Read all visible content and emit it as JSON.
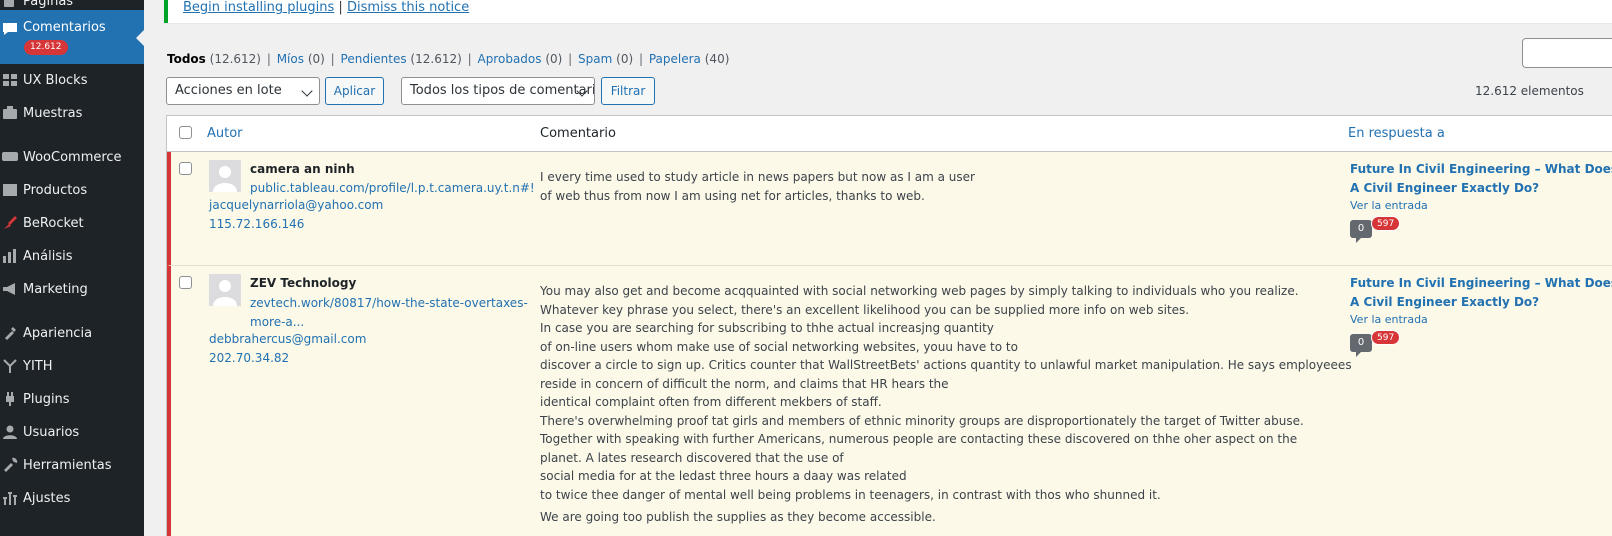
{
  "sidebar": {
    "items": [
      {
        "label": "Páginas",
        "icon": "pages-icon"
      },
      {
        "label": "Comentarios",
        "icon": "comments-icon",
        "count": "12.612"
      },
      {
        "label": "UX Blocks",
        "icon": "ux-blocks-icon"
      },
      {
        "label": "Muestras",
        "icon": "portfolio-icon"
      },
      {
        "label": "WooCommerce",
        "icon": "woocommerce-icon"
      },
      {
        "label": "Productos",
        "icon": "products-icon"
      },
      {
        "label": "BeRocket",
        "icon": "berocket-icon"
      },
      {
        "label": "Análisis",
        "icon": "analytics-icon"
      },
      {
        "label": "Marketing",
        "icon": "marketing-icon"
      },
      {
        "label": "Apariencia",
        "icon": "appearance-icon"
      },
      {
        "label": "YITH",
        "icon": "yith-icon"
      },
      {
        "label": "Plugins",
        "icon": "plugins-icon"
      },
      {
        "label": "Usuarios",
        "icon": "users-icon"
      },
      {
        "label": "Herramientas",
        "icon": "tools-icon"
      },
      {
        "label": "Ajustes",
        "icon": "settings-icon"
      }
    ]
  },
  "notice": {
    "install_link": "Begin installing plugins",
    "separator": "|",
    "dismiss_link": "Dismiss this notice"
  },
  "filters": {
    "all": {
      "label": "Todos",
      "count": "(12.612)"
    },
    "mine": {
      "label": "Míos",
      "count": "(0)"
    },
    "pending": {
      "label": "Pendientes",
      "count": "(12.612)"
    },
    "approved": {
      "label": "Aprobados",
      "count": "(0)"
    },
    "spam": {
      "label": "Spam",
      "count": "(0)"
    },
    "trash": {
      "label": "Papelera",
      "count": "(40)"
    },
    "sep": "|"
  },
  "tablenav": {
    "bulk_actions": "Acciones en lote",
    "apply": "Aplicar",
    "comment_type": "Todos los tipos de comentarios",
    "filter": "Filtrar",
    "items_count": "12.612 elementos"
  },
  "table": {
    "headers": {
      "author": "Autor",
      "comment": "Comentario",
      "in_response": "En respuesta a"
    },
    "rows": [
      {
        "author": "camera an ninh",
        "url": "public.tableau.com/profile/l.p.t.camera.uy.t.n#!",
        "email": "jacquelynarriola@yahoo.com",
        "ip": "115.72.166.146",
        "comment_lines": [
          "I every time used to study article in news papers but now as I am a user",
          "of web thus from now I am using net for articles, thanks to web."
        ],
        "response_title_lines": [
          "Future In Civil Engineering – What Does",
          "A Civil Engineer Exactly Do?"
        ],
        "view_post": "Ver la entrada",
        "approved_count": "0",
        "pending_count": "597"
      },
      {
        "author": "ZEV Technology",
        "url_lines": [
          "zevtech.work/80817/how-the-state-overtaxes-",
          "more-a..."
        ],
        "email": "debbrahercus@gmail.com",
        "ip": "202.70.34.82",
        "comment_lines": [
          "You may also get and become acqquainted with social networking web pages by simply talking to individuals who you realize.",
          "Whatever key phrase you select, there's an excellent likelihood you can be supplied more info on web sites.",
          "In case you are searching for subscribing to thhe actual increasjng quantity",
          "of on-line users whom make use of social networking websites, youu have to to",
          "discover a circle to sign up. Critics counter that WallStreetBets' actions quantity to unlawful market manipulation. He says employeees",
          "reside in concern of difficult the norm, and claims that HR hears the",
          "identical complaint often from different mekbers of staff.",
          "There's overwhelming proof tat girls and members of ethnic minority groups are disproportionately the target of Twitter abuse.",
          "Together with speaking with further Americans, numerous people are contacting these discovered on thhe oher aspect on the",
          "planet. A lates research discovered that the use of",
          "social media for at the ledast three hours a daay was related",
          "to twice thee danger of mental well being problems in teenagers, in contrast with thos who shunned it.",
          "We are going too publish the supplies as they become accessible."
        ],
        "response_title_lines": [
          "Future In Civil Engineering – What Does",
          "A Civil Engineer Exactly Do?"
        ],
        "view_post": "Ver la entrada",
        "approved_count": "0",
        "pending_count": "597"
      }
    ]
  },
  "colors": {
    "sidebar_bg": "#1d2327",
    "active_bg": "#2271b1",
    "link": "#2271b1",
    "pending_row_bg": "#fcf9e8",
    "pending_border": "#d63638",
    "notice_border": "#00a32a"
  }
}
